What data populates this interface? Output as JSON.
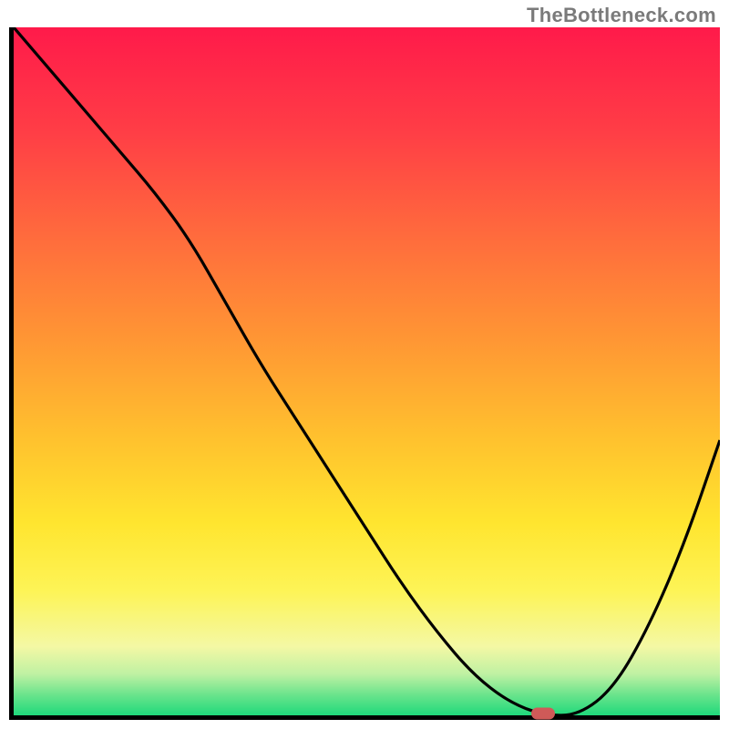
{
  "watermark": "TheBottleneck.com",
  "chart_data": {
    "type": "line",
    "title": "",
    "xlabel": "",
    "ylabel": "",
    "xlim": [
      0,
      100
    ],
    "ylim": [
      0,
      100
    ],
    "x": [
      0,
      5,
      10,
      15,
      20,
      25,
      30,
      35,
      40,
      45,
      50,
      55,
      60,
      65,
      70,
      75,
      80,
      85,
      90,
      95,
      100
    ],
    "values": [
      100,
      94,
      88,
      82,
      76,
      69,
      60,
      51,
      43,
      35,
      27,
      19,
      12,
      6,
      2,
      0,
      0,
      4,
      13,
      25,
      40
    ],
    "gradient_stops": [
      {
        "pos": 0.0,
        "color": "#ff1a4a"
      },
      {
        "pos": 0.15,
        "color": "#ff3d46"
      },
      {
        "pos": 0.3,
        "color": "#ff6a3d"
      },
      {
        "pos": 0.45,
        "color": "#ff9534"
      },
      {
        "pos": 0.6,
        "color": "#ffc22e"
      },
      {
        "pos": 0.72,
        "color": "#ffe52f"
      },
      {
        "pos": 0.82,
        "color": "#fdf457"
      },
      {
        "pos": 0.9,
        "color": "#f4f8a4"
      },
      {
        "pos": 0.94,
        "color": "#bff1a3"
      },
      {
        "pos": 0.97,
        "color": "#6be48c"
      },
      {
        "pos": 1.0,
        "color": "#1fd97b"
      }
    ],
    "marker": {
      "x": 75,
      "y": 0,
      "color": "#cf5a58"
    }
  }
}
